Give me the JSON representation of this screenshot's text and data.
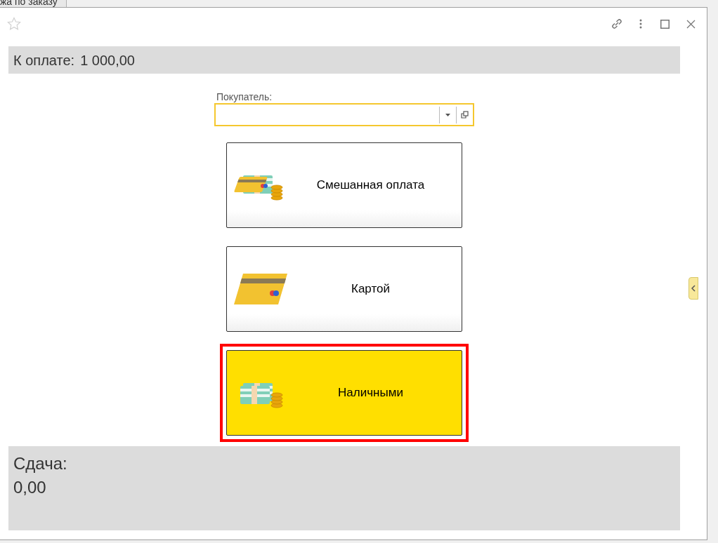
{
  "background_tab": {
    "title": "жа по заказу"
  },
  "to_pay": {
    "label": "К оплате:",
    "amount": "1 000,00"
  },
  "customer": {
    "label": "Покупатель:"
  },
  "payment_options": [
    {
      "label": "Смешанная оплата",
      "kind": "mixed",
      "selected": false
    },
    {
      "label": "Картой",
      "kind": "card",
      "selected": false
    },
    {
      "label": "Наличными",
      "kind": "cash",
      "selected": true
    }
  ],
  "change": {
    "label": "Сдача:",
    "amount": "0,00"
  }
}
